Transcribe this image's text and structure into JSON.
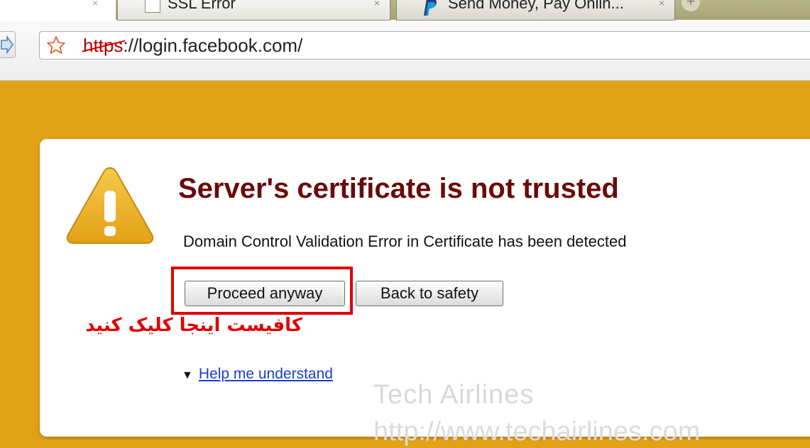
{
  "tabs": [
    {
      "title": "SSL Error",
      "close": "×"
    },
    {
      "title": "Send Money, Pay Onlin...",
      "close": "×"
    }
  ],
  "toolbar": {
    "url_protocol": "https",
    "url_rest": "://login.facebook.com/"
  },
  "error_page": {
    "heading": "Server's certificate is not trusted",
    "description": "Domain Control Validation Error in Certificate has been detected",
    "proceed_label": "Proceed anyway",
    "back_label": "Back to safety",
    "help_label": "Help me understand",
    "help_arrow": "▼"
  },
  "annotation": {
    "text": "کافیست اینجا کلیک کنید",
    "color": "#e00000"
  },
  "watermark": {
    "text": "Tech Airlines",
    "url": "http://www.techairlines.com"
  },
  "colors": {
    "page_background": "#e3a117",
    "heading": "#6a0a0a",
    "link": "#1a3ec9",
    "highlight": "#e00000"
  },
  "icons": {
    "tab1": "document-icon",
    "tab2": "paypal-icon",
    "toolbar": "star-icon",
    "warning": "warning-triangle-icon"
  }
}
